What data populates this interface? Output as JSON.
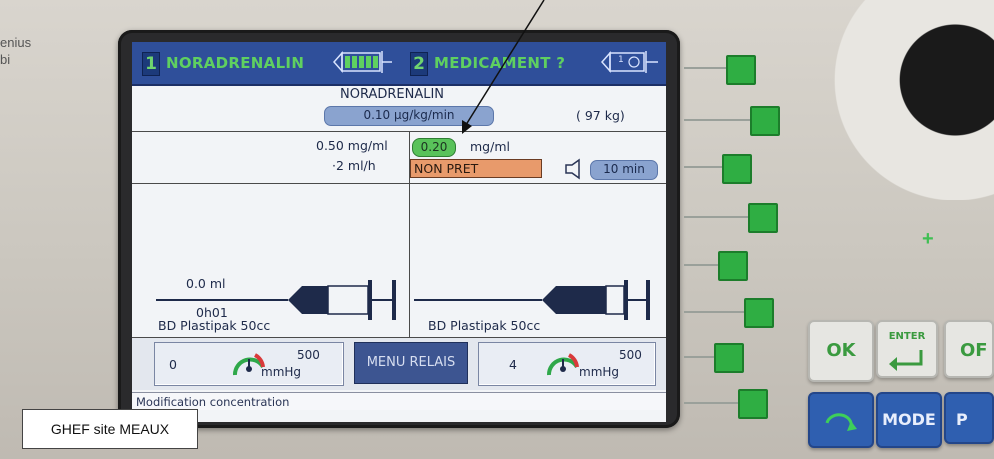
{
  "device": {
    "brand_fragment": "enius\nbi"
  },
  "header": {
    "channel1_number": "1",
    "channel1_name": "NORADRENALIN",
    "channel2_number": "2",
    "channel2_name": "MEDICAMENT ?",
    "channel2_battery_label": "1"
  },
  "drug": {
    "name": "NORADRENALIN",
    "dose": "0.10 µg/kg/min",
    "weight": "( 97 kg)"
  },
  "left_syringe": {
    "concentration": "0.50 mg/ml",
    "rate": "·2 ml/h",
    "volume": "0.0 ml",
    "time": "0h01",
    "model": "BD Plastipak 50cc"
  },
  "right_syringe": {
    "concentration_value": "0.20",
    "concentration_unit": "mg/ml",
    "state": "NON PRET",
    "alarm_time": "10 min",
    "model": "BD Plastipak 50cc"
  },
  "pressure_left": {
    "value": "0",
    "max": "500",
    "unit": "mmHg"
  },
  "pressure_right": {
    "value": "4",
    "max": "500",
    "unit": "mmHg"
  },
  "menu_button": "MENU RELAIS",
  "status_text": "Modification concentration",
  "keys": {
    "ok": "OK",
    "enter": "ENTER",
    "mode": "MODE",
    "partial_right": "OF",
    "partial_blue": "P"
  },
  "caption": "GHEF site MEAUX",
  "colors": {
    "header_blue": "#2f4f9a",
    "channel_green": "#5fd060",
    "softkey_green": "#2fae43",
    "state_orange": "#e89a6b"
  }
}
